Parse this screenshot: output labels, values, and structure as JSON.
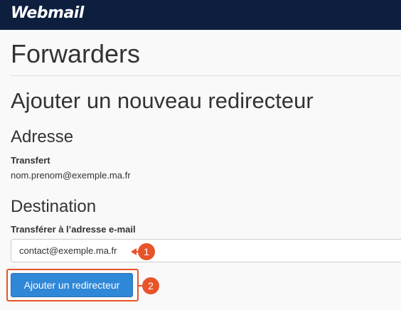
{
  "header": {
    "logo_text": "Webmail"
  },
  "page": {
    "title": "Forwarders",
    "section_title": "Ajouter un nouveau redirecteur"
  },
  "address": {
    "heading": "Adresse",
    "label": "Transfert",
    "value": "nom.prenom@exemple.ma.fr"
  },
  "destination": {
    "heading": "Destination",
    "label": "Transférer à l’adresse e-mail",
    "input_value": "contact@exemple.ma.fr"
  },
  "actions": {
    "add_button_label": "Ajouter un redirecteur"
  },
  "annotations": {
    "marker_1": "1",
    "marker_2": "2",
    "color": "#e8542a"
  },
  "colors": {
    "header_bg": "#0d1e3f",
    "button_bg": "#2f87d8",
    "page_bg": "#f9f9f9"
  }
}
